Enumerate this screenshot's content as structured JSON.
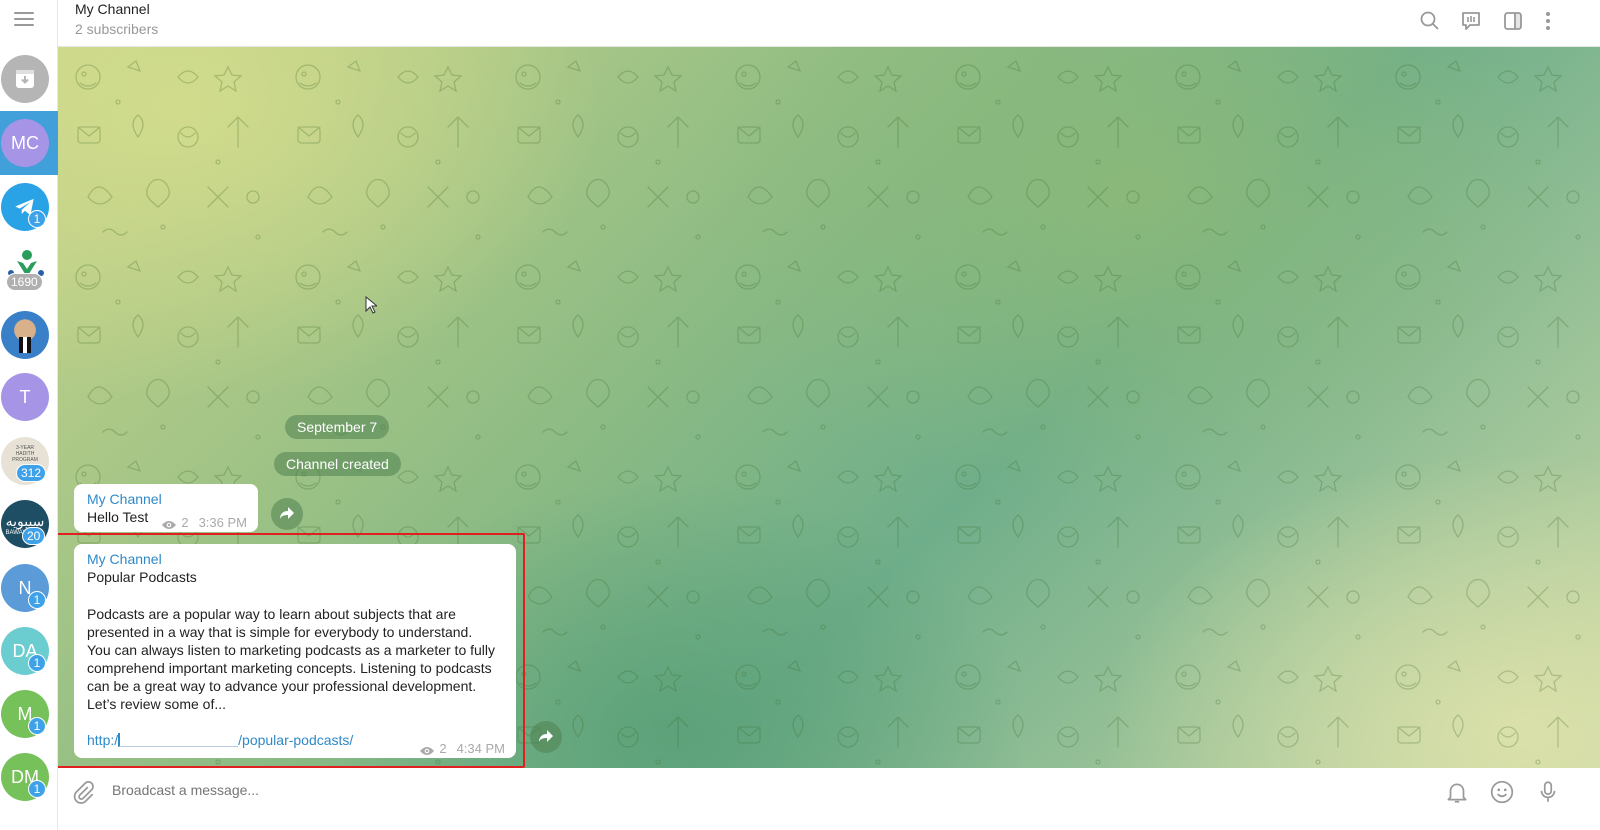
{
  "header": {
    "title": "My Channel",
    "subtitle": "2 subscribers",
    "icons": [
      "search-icon",
      "live-chat-icon",
      "sidebar-toggle-icon",
      "more-vertical-icon"
    ]
  },
  "sidebar": {
    "items": [
      {
        "name": "archive",
        "initials": "",
        "color": "#b5b5b5",
        "badge": ""
      },
      {
        "name": "my-channel",
        "initials": "MC",
        "color": "#a695e7",
        "badge": "",
        "active": true
      },
      {
        "name": "telegram",
        "initials": "",
        "color": "#2aa3e6",
        "badge": "1"
      },
      {
        "name": "logo-chat",
        "initials": "",
        "color": "#ffffff",
        "badge": "1690"
      },
      {
        "name": "photo-chat",
        "initials": "",
        "color": "#3a80c8",
        "badge": ""
      },
      {
        "name": "t-chat",
        "initials": "T",
        "color": "#a695e7",
        "badge": ""
      },
      {
        "name": "hadith-program",
        "initials": "",
        "color": "#e8e2d6",
        "badge": "312"
      },
      {
        "name": "arabic-channel",
        "initials": "",
        "color": "#1d4e64",
        "badge": "20"
      },
      {
        "name": "n-chat",
        "initials": "N",
        "color": "#5b9bd8",
        "badge": "1"
      },
      {
        "name": "da-chat",
        "initials": "DA",
        "color": "#6ccdd1",
        "badge": "1"
      },
      {
        "name": "m-chat",
        "initials": "M",
        "color": "#77c15b",
        "badge": "1"
      },
      {
        "name": "dm-chat",
        "initials": "DM",
        "color": "#77c15b",
        "badge": "1"
      }
    ],
    "hadith_label": "3-YEAR HADITH PROGRAM",
    "arabic_label": "سيبويه",
    "arabic_sub": "BAWAYH"
  },
  "chat": {
    "date_pill": "September 7",
    "service_pill": "Channel created",
    "messages": [
      {
        "author": "My Channel",
        "text": "Hello Test",
        "views": "2",
        "time": "3:36 PM"
      },
      {
        "author": "My Channel",
        "title": "Popular Podcasts",
        "body": [
          "Podcasts are a popular way to learn about subjects that are",
          "presented in a way that is simple for everybody to understand.",
          "You can always listen to marketing podcasts as a marketer to fully",
          "comprehend important marketing concepts. Listening to podcasts",
          "can be a great way to advance your professional development.",
          "Let’s review some of..."
        ],
        "link_prefix": "http:/",
        "link_suffix": "/popular-podcasts/",
        "views": "2",
        "time": "4:34 PM"
      }
    ]
  },
  "composer": {
    "placeholder": "Broadcast a message..."
  },
  "colors": {
    "accent": "#419fd9",
    "link": "#2f89c9",
    "highlight": "#e02020",
    "badge": "#3fa2e8"
  }
}
